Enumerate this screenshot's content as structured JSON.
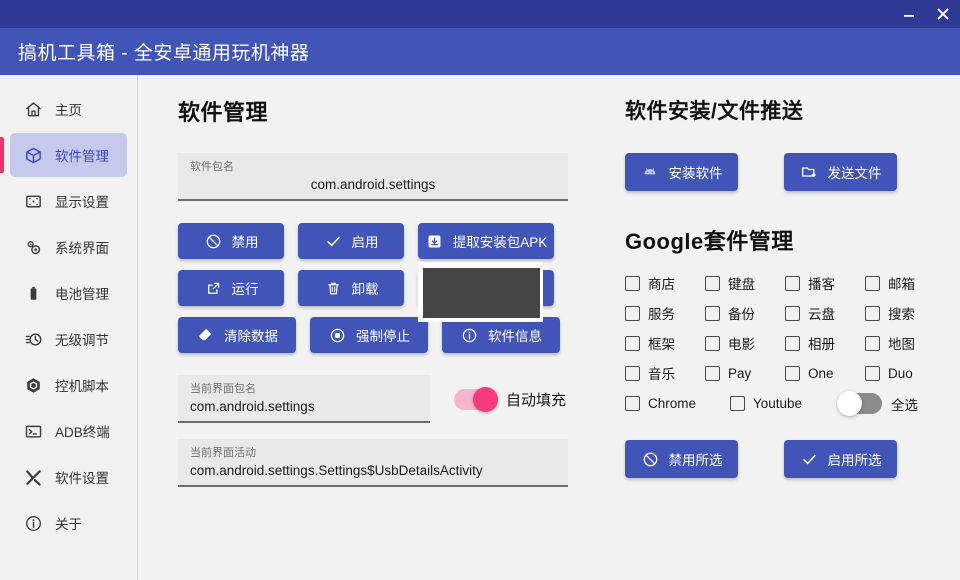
{
  "window": {
    "title": "搞机工具箱 - 全安卓通用玩机神器",
    "minimize_label": "minimize",
    "close_label": "close"
  },
  "sidebar": {
    "items": [
      {
        "label": "主页",
        "icon": "home-icon",
        "active": false
      },
      {
        "label": "软件管理",
        "icon": "package-icon",
        "active": true
      },
      {
        "label": "显示设置",
        "icon": "display-icon",
        "active": false
      },
      {
        "label": "系统界面",
        "icon": "gears-icon",
        "active": false
      },
      {
        "label": "电池管理",
        "icon": "battery-icon",
        "active": false
      },
      {
        "label": "无级调节",
        "icon": "clock-slider-icon",
        "active": false
      },
      {
        "label": "控机脚本",
        "icon": "hexagon-icon",
        "active": false
      },
      {
        "label": "ADB终端",
        "icon": "terminal-icon",
        "active": false
      },
      {
        "label": "软件设置",
        "icon": "tools-icon",
        "active": false
      },
      {
        "label": "关于",
        "icon": "info-icon",
        "active": false
      }
    ]
  },
  "software_management": {
    "title": "软件管理",
    "package_field": {
      "label": "软件包名",
      "value": "com.android.settings"
    },
    "actions_row1": [
      {
        "label": "禁用",
        "icon": "ban-icon"
      },
      {
        "label": "启用",
        "icon": "check-icon"
      },
      {
        "label": "提取安装包APK",
        "icon": "download-box-icon"
      }
    ],
    "actions_row2": [
      {
        "label": "运行",
        "icon": "external-link-icon"
      },
      {
        "label": "卸载",
        "icon": "trash-icon"
      },
      {
        "label": "",
        "icon": "obscured-icon"
      }
    ],
    "actions_row3": [
      {
        "label": "清除数据",
        "icon": "eraser-icon"
      },
      {
        "label": "强制停止",
        "icon": "stop-circle-icon"
      },
      {
        "label": "软件信息",
        "icon": "info-circle-icon"
      }
    ],
    "current_package_field": {
      "label": "当前界面包名",
      "value": "com.android.settings"
    },
    "current_activity_field": {
      "label": "当前界面活动",
      "value": "com.android.settings.Settings$UsbDetailsActivity"
    },
    "autofill_toggle": {
      "label": "自动填充",
      "state": "on"
    }
  },
  "install_push": {
    "title": "软件安装/文件推送",
    "buttons": [
      {
        "label": "安装软件",
        "icon": "android-icon"
      },
      {
        "label": "发送文件",
        "icon": "folder-arrow-icon"
      }
    ]
  },
  "google_suite": {
    "title": "Google套件管理",
    "checkboxes": [
      {
        "label": "商店",
        "checked": false
      },
      {
        "label": "键盘",
        "checked": false
      },
      {
        "label": "播客",
        "checked": false
      },
      {
        "label": "邮箱",
        "checked": false
      },
      {
        "label": "服务",
        "checked": false
      },
      {
        "label": "备份",
        "checked": false
      },
      {
        "label": "云盘",
        "checked": false
      },
      {
        "label": "搜索",
        "checked": false
      },
      {
        "label": "框架",
        "checked": false
      },
      {
        "label": "电影",
        "checked": false
      },
      {
        "label": "相册",
        "checked": false
      },
      {
        "label": "地图",
        "checked": false
      },
      {
        "label": "音乐",
        "checked": false
      },
      {
        "label": "Pay",
        "checked": false
      },
      {
        "label": "One",
        "checked": false
      },
      {
        "label": "Duo",
        "checked": false
      }
    ],
    "checkboxes_last_row": [
      {
        "label": "Chrome",
        "checked": false
      },
      {
        "label": "Youtube",
        "checked": false
      }
    ],
    "select_all_toggle": {
      "label": "全选",
      "state": "off"
    },
    "buttons": [
      {
        "label": "禁用所选",
        "icon": "ban-icon"
      },
      {
        "label": "启用所选",
        "icon": "check-icon"
      }
    ]
  },
  "colors": {
    "titlebar": "#2e3a94",
    "header": "#4154b8",
    "accent_button": "#4154b8",
    "sidebar_active_bg": "#c5c9ec",
    "sidebar_active_text": "#3a46c8",
    "sidebar_indicator": "#f4306d",
    "toggle_on": "#f83a7e",
    "toggle_off": "#8c8c8c",
    "background": "#f2f2f2",
    "overlay_box": "#454545"
  }
}
